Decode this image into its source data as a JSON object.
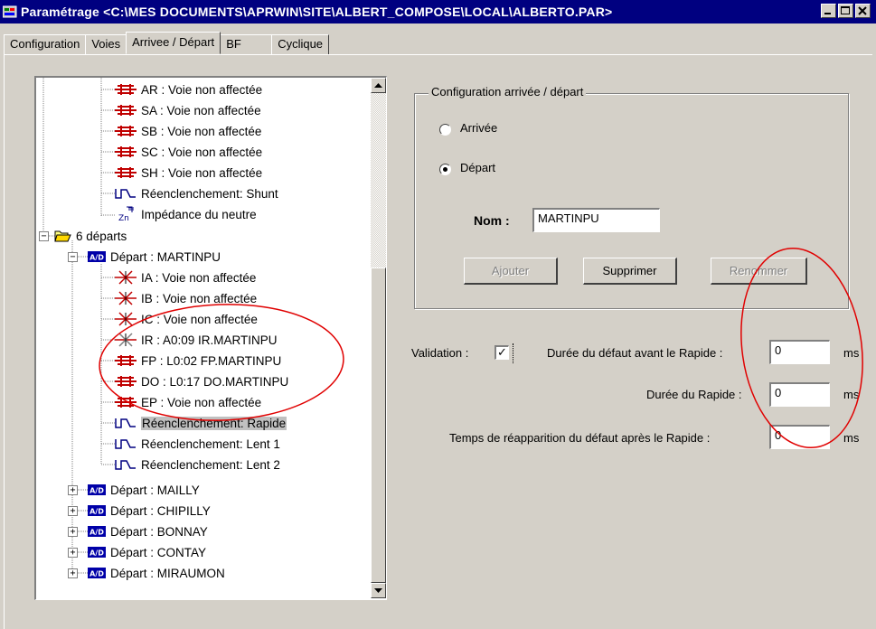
{
  "window": {
    "title": "Paramétrage  <C:\\MES DOCUMENTS\\APRWIN\\SITE\\ALBERT_COMPOSE\\LOCAL\\ALBERTO.PAR>"
  },
  "tabs": [
    "Configuration",
    "Voies",
    "Arrivee / Départ",
    "BF",
    "Cyclique"
  ],
  "tree": {
    "items": [
      {
        "label": "AR : Voie non affectée",
        "icon": "voie-red-icon"
      },
      {
        "label": "SA : Voie non affectée",
        "icon": "voie-red-icon"
      },
      {
        "label": "SB : Voie non affectée",
        "icon": "voie-red-icon"
      },
      {
        "label": "SC : Voie non affectée",
        "icon": "voie-red-icon"
      },
      {
        "label": "SH : Voie non affectée",
        "icon": "voie-red-icon"
      },
      {
        "label": "Réenclenchement: Shunt",
        "icon": "reenclenchement-icon"
      },
      {
        "label": "Impédance du neutre",
        "icon": "impedance-icon"
      },
      {
        "label": "6 départs",
        "icon": "folder-open-icon"
      },
      {
        "label": "Départ : MARTINPU",
        "icon": "ad-icon"
      },
      {
        "label": "IA : Voie non affectée",
        "icon": "voie-crossed-icon"
      },
      {
        "label": "IB : Voie non affectée",
        "icon": "voie-crossed-icon"
      },
      {
        "label": "IC : Voie non affectée",
        "icon": "voie-crossed-icon"
      },
      {
        "label": "IR : A0:09 IR.MARTINPU",
        "icon": "voie-crossed-icon"
      },
      {
        "label": "FP : L0:02 FP.MARTINPU",
        "icon": "voie-red-icon"
      },
      {
        "label": "DO : L0:17 DO.MARTINPU",
        "icon": "voie-red-icon"
      },
      {
        "label": "EP : Voie non affectée",
        "icon": "voie-red-icon"
      },
      {
        "label": "Réenclenchement: Rapide",
        "icon": "reenclenchement-icon",
        "selected": true
      },
      {
        "label": "Réenclenchement: Lent 1",
        "icon": "reenclenchement-icon"
      },
      {
        "label": "Réenclenchement: Lent 2",
        "icon": "reenclenchement-icon"
      },
      {
        "label": "Départ : MAILLY",
        "icon": "ad-icon"
      },
      {
        "label": "Départ : CHIPILLY",
        "icon": "ad-icon"
      },
      {
        "label": "Départ : BONNAY",
        "icon": "ad-icon"
      },
      {
        "label": "Départ : CONTAY",
        "icon": "ad-icon"
      },
      {
        "label": "Départ : MIRAUMON",
        "icon": "ad-icon"
      }
    ]
  },
  "config": {
    "group_title": "Configuration arrivée / départ",
    "radio_arrivee": "Arrivée",
    "radio_depart": "Départ",
    "selected_radio": "Départ",
    "nom_label": "Nom :",
    "nom_value": "MARTINPU",
    "btn_ajouter": "Ajouter",
    "btn_supprimer": "Supprimer",
    "btn_renommer": "Renommer"
  },
  "validation": {
    "label": "Validation :",
    "checked": true,
    "check_mark": "✓",
    "duree_defaut_label": "Durée du défaut avant le Rapide :",
    "duree_defaut_value": "0",
    "duree_rapide_label": "Durée du Rapide :",
    "duree_rapide_value": "0",
    "temps_reapparition_label": "Temps de réapparition du défaut après le Rapide :",
    "temps_reapparition_value": "0",
    "unit": "ms"
  },
  "colors": {
    "title_bar": "#000080",
    "annotation": "#e00000",
    "face": "#d4d0c8",
    "ad_icon": "#0000a8"
  }
}
